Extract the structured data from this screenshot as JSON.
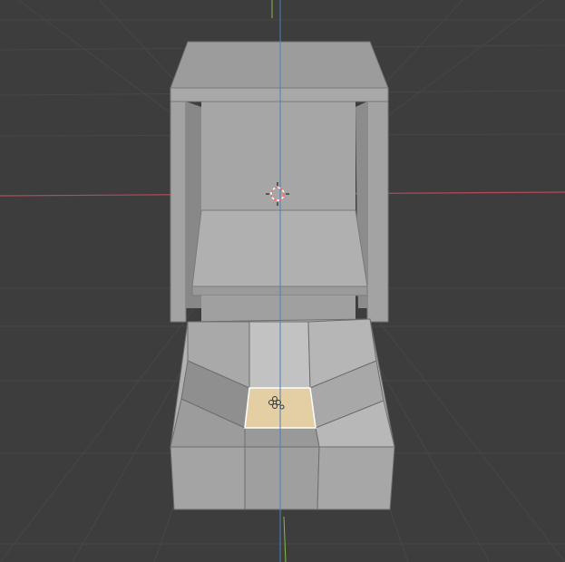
{
  "scene": {
    "background_color": "#3d3d3d",
    "grid_color": "#4a4a4a",
    "x_axis_color": "#b54a5a",
    "y_axis_color": "#8bb84a",
    "z_axis_color": "#4a7fc0",
    "mesh_color": "#a5a5a5",
    "edge_color": "#6e6e6e",
    "selected_face_color": "#e4cfa5",
    "selected_edge_color": "#ffffff",
    "icons": {
      "cursor": "3d-cursor-icon",
      "origin": "object-origin-icon",
      "gizmo": "selection-gizmo-icon"
    }
  }
}
